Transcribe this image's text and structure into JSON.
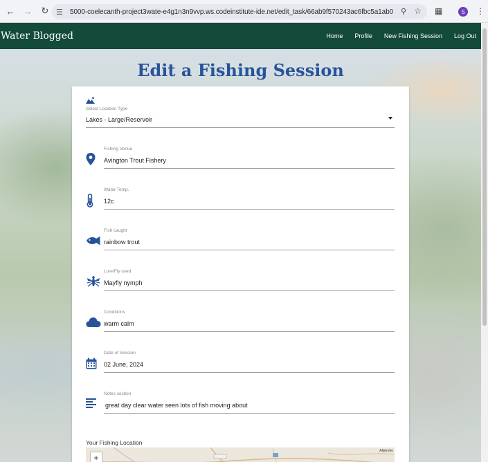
{
  "browser": {
    "url": "5000-coelecanth-project3wate-e4g1n3n9vvp.ws.codeinstitute-ide.net/edit_task/66ab9f570243ac6fbc5a1ab0",
    "profile_initial": "S"
  },
  "nav": {
    "brand": "Water Blogged",
    "links": [
      "Home",
      "Profile",
      "New Fishing Session",
      "Log Out"
    ]
  },
  "page_title": "Edit a Fishing Session",
  "form": {
    "location_type": {
      "label": "Select Location Type",
      "value": "Lakes - Large/Reservoir"
    },
    "venue": {
      "label": "Fishing Venue",
      "value": "Avington Trout Fishery",
      "icon": "location-pin-icon"
    },
    "water_temp": {
      "label": "Water Temp.",
      "value": "12c",
      "icon": "thermometer-icon"
    },
    "fish_caught": {
      "label": "Fish caught",
      "value": "rainbow trout",
      "icon": "fish-icon"
    },
    "lure": {
      "label": "Lure/Fly used",
      "value": "Mayfly nymph",
      "icon": "mosquito-icon"
    },
    "conditions": {
      "label": "Conditions",
      "value": "warm calm",
      "icon": "cloud-icon"
    },
    "date": {
      "label": "Date of Session",
      "value": "02 June, 2024",
      "icon": "calendar-icon"
    },
    "notes": {
      "label": "Notes section",
      "value": "great day clear water seen lots of fish moving about",
      "icon": "notes-icon"
    }
  },
  "map": {
    "label": "Your Fishing Location",
    "zoom_in": "+",
    "place_label": "Aldersho"
  },
  "colors": {
    "nav_bg": "#134a3a",
    "accent": "#27539b"
  }
}
